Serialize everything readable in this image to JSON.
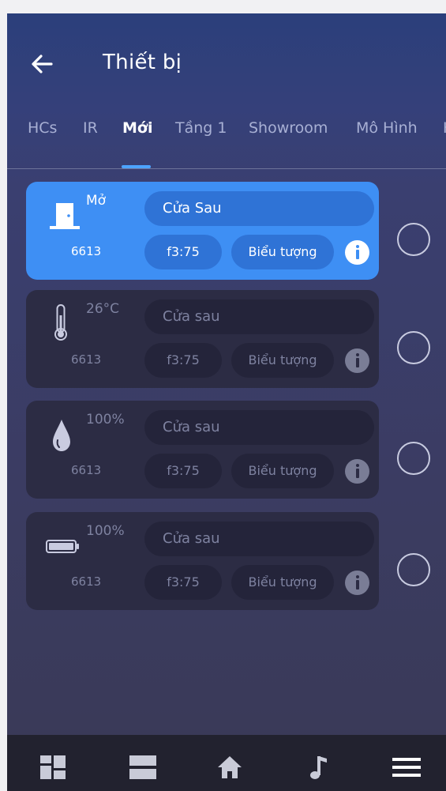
{
  "header": {
    "title": "Thiết bị"
  },
  "tabs": [
    {
      "label": "HCs"
    },
    {
      "label": "IR"
    },
    {
      "label": "Mới"
    },
    {
      "label": "Tầng 1"
    },
    {
      "label": "Showroom"
    },
    {
      "label": "Mô Hình"
    },
    {
      "label": "K"
    }
  ],
  "active_tab": "Mới",
  "accent_color": "#3e8ff4",
  "devices": [
    {
      "icon": "door-icon",
      "status": "Mở",
      "device_id": "6613",
      "name": "Cửa Sau",
      "address": "f3:75",
      "icon_label": "Biểu tượng",
      "selected": true
    },
    {
      "icon": "thermometer-icon",
      "status": "26°C",
      "device_id": "6613",
      "name": "Cửa sau",
      "address": "f3:75",
      "icon_label": "Biểu tượng",
      "selected": false
    },
    {
      "icon": "water-drop-icon",
      "status": "100%",
      "device_id": "6613",
      "name": "Cửa sau",
      "address": "f3:75",
      "icon_label": "Biểu tượng",
      "selected": false
    },
    {
      "icon": "battery-icon",
      "status": "100%",
      "device_id": "6613",
      "name": "Cửa sau",
      "address": "f3:75",
      "icon_label": "Biểu tượng",
      "selected": false
    }
  ],
  "bottom_nav": [
    {
      "icon": "dashboard-grid-icon"
    },
    {
      "icon": "rooms-list-icon"
    },
    {
      "icon": "home-icon"
    },
    {
      "icon": "music-note-icon"
    },
    {
      "icon": "menu-icon"
    }
  ]
}
